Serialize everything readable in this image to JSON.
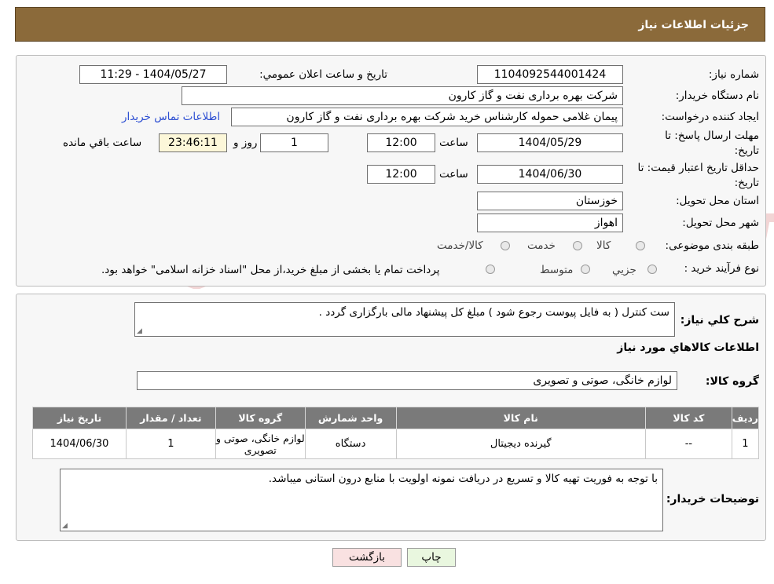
{
  "header": {
    "title": "جزئیات اطلاعات نیاز"
  },
  "form": {
    "need_number_label": "شماره نیاز:",
    "need_number": "1104092544001424",
    "announce_label": "تاریخ و ساعت اعلان عمومي:",
    "announce_value": "1404/05/27 - 11:29",
    "buyer_org_label": "نام دستگاه خريدار:",
    "buyer_org": "شرکت بهره برداری نفت و گاز کارون",
    "creator_label": "ايجاد کننده درخواست:",
    "creator": "پیمان غلامی حموله کارشناس خرید شرکت بهره برداری نفت و گاز کارون",
    "contact_link": "اطلاعات تماس خريدار",
    "deadline_label_1": "مهلت ارسال پاسخ: تا",
    "deadline_label_2": "تاريخ:",
    "deadline_date": "1404/05/29",
    "time_label": "ساعت",
    "deadline_time": "12:00",
    "days_value": "1",
    "days_label": "روز و",
    "remaining_time": "23:46:11",
    "remaining_label": "ساعت باقي مانده",
    "validity_label_1": "حداقل تاريخ اعتبار قيمت: تا",
    "validity_label_2": "تاريخ:",
    "validity_date": "1404/06/30",
    "validity_time": "12:00",
    "province_label": "استان محل تحويل:",
    "province": "خوزستان",
    "city_label": "شهر محل تحويل:",
    "city": "اهواز",
    "category_label": "طبقه بندی موضوعی:",
    "category_options": [
      "کالا",
      "خدمت",
      "کالا/خدمت"
    ],
    "purchase_type_label": "نوع فرآیند خرید :",
    "purchase_options": [
      "جزیي",
      "متوسط"
    ],
    "purchase_note": "پرداخت تمام یا بخشی از مبلغ خرید،از محل \"اسناد خزانه اسلامی\" خواهد بود."
  },
  "details": {
    "description_label": "شرح کلي نياز:",
    "description": "ست کنترل ( به فایل پیوست رجوع شود ) مبلغ کل پیشنهاد مالی بارگزاری گردد .",
    "items_title": "اطلاعات کالاهاي مورد نياز",
    "goods_group_label": "گروه کالا:",
    "goods_group": "لوازم خانگی، صوتی و تصویری",
    "table": {
      "headers": [
        "رديف",
        "کد کالا",
        "نام کالا",
        "واحد شمارش",
        "گروه کالا",
        "تعداد / مقدار",
        "تاريخ نياز"
      ],
      "rows": [
        [
          "1",
          "--",
          "گیرنده دیجیتال",
          "دستگاه",
          "لوازم خانگی، صوتی و تصویری",
          "1",
          "1404/06/30"
        ]
      ]
    },
    "buyer_notes_label": "توضيحات خريدار:",
    "buyer_notes": "با توجه به فوریت تهیه کالا و تسریع در دریافت نمونه اولویت با منابع درون استانی میباشد."
  },
  "buttons": {
    "print": "چاپ",
    "back": "بازگشت"
  },
  "watermark": {
    "text": "AriaTender.neT"
  }
}
